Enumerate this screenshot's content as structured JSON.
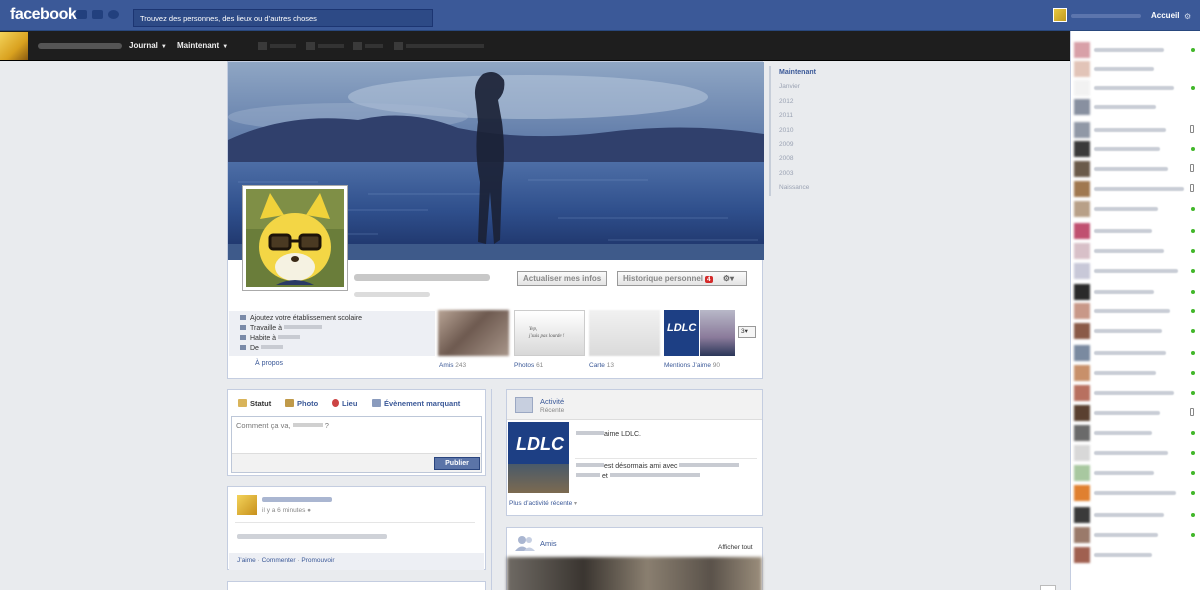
{
  "topbar": {
    "logo": "facebook",
    "search_placeholder": "Trouvez des personnes, des lieux ou d’autres choses",
    "home_label": "Accueil"
  },
  "timeline_bar": {
    "journal_label": "Journal",
    "maintenant_label": "Maintenant"
  },
  "profile": {
    "update_info_label": "Actualiser mes infos",
    "activity_log_label": "Historique personnel",
    "activity_log_badge": "4",
    "info": {
      "school": "Ajoutez votre établissement scolaire",
      "work": "Travaille à",
      "lives": "Habite à",
      "from": "De"
    },
    "about_label": "À propos",
    "thumbs": [
      {
        "label": "Amis",
        "count": "243"
      },
      {
        "label": "Photos",
        "count": "61"
      },
      {
        "label": "Carte",
        "count": "13"
      },
      {
        "label": "Mentions J’aime",
        "count": "90"
      }
    ],
    "more_label": "3",
    "photo_caption": [
      "Yep,",
      "j'suis pas lourde !"
    ]
  },
  "timeline_nav": [
    "Maintenant",
    "Janvier",
    "2012",
    "2011",
    "2010",
    "2009",
    "2008",
    "2003",
    "Naissance"
  ],
  "composer": {
    "tabs": [
      "Statut",
      "Photo",
      "Lieu",
      "Évènement marquant"
    ],
    "placeholder_prefix": "Comment ça va,",
    "placeholder_suffix": "?",
    "publish_label": "Publier"
  },
  "post": {
    "time": "il y a 6 minutes",
    "actions": [
      "J’aime",
      "Commenter",
      "Promouvoir"
    ]
  },
  "activity": {
    "title": "Activité",
    "subtitle": "Récente",
    "item1_text": "aime LDLC.",
    "item2_text": "est désormais ami avec",
    "item2_and": "et",
    "more_label": "Plus d’activité récente",
    "logo_text": "LDLC"
  },
  "friends": {
    "title": "Amis",
    "see_all": "Afficher tout"
  },
  "colors": {
    "brand_blue": "#3b5998",
    "dark_bar": "#1e1e1e",
    "online_green": "#42b72a",
    "badge_red": "#d42a2a"
  }
}
